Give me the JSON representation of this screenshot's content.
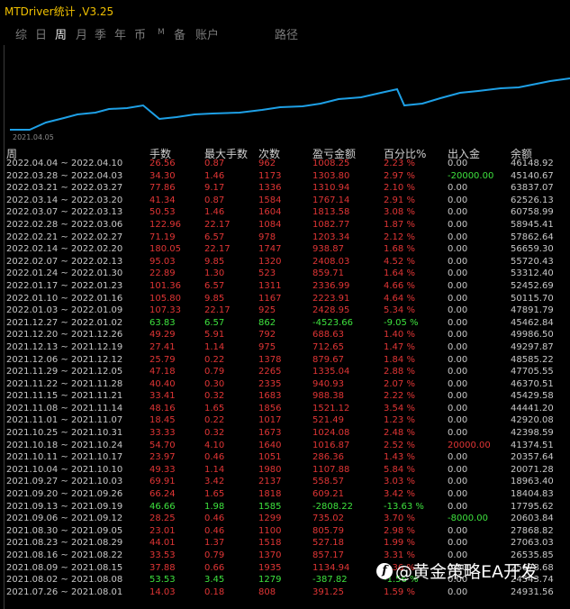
{
  "window": {
    "title": "MTDriver统计 ,V3.25"
  },
  "tabs": [
    {
      "label": "综",
      "active": false
    },
    {
      "label": "日",
      "active": false
    },
    {
      "label": "周",
      "active": true
    },
    {
      "label": "月",
      "active": false
    },
    {
      "label": "季",
      "active": false
    },
    {
      "label": "年",
      "active": false
    },
    {
      "label": "币",
      "active": false
    },
    {
      "label": "M",
      "active": false
    },
    {
      "label": "备",
      "active": false
    },
    {
      "label": "账户",
      "active": false
    },
    {
      "label": "路径",
      "active": false
    }
  ],
  "chart": {
    "start_date": "2021.04.05",
    "line_color": "#1ea0e6"
  },
  "columns": {
    "week": "周",
    "trades": "手数",
    "max_lots": "最大手数",
    "count": "次数",
    "pnl": "盈亏金额",
    "pct": "百分比%",
    "io": "出入金",
    "balance": "余额"
  },
  "colors": {
    "profit": "#e03535",
    "loss": "#3ee23e",
    "neutral": "#c8c8c8"
  },
  "rows": [
    {
      "week": "2022.04.04 ~ 2022.04.10",
      "trades": "26.56",
      "max": "0.87",
      "count": "962",
      "pnl": "1008.25",
      "pct": "2.23 %",
      "io": "0.00",
      "bal": "46148.92",
      "t": "p",
      "iot": "n"
    },
    {
      "week": "2022.03.28 ~ 2022.04.03",
      "trades": "34.30",
      "max": "1.46",
      "count": "1173",
      "pnl": "1303.80",
      "pct": "2.97 %",
      "io": "-20000.00",
      "bal": "45140.67",
      "t": "p",
      "iot": "g"
    },
    {
      "week": "2022.03.21 ~ 2022.03.27",
      "trades": "77.86",
      "max": "9.17",
      "count": "1336",
      "pnl": "1310.94",
      "pct": "2.10 %",
      "io": "0.00",
      "bal": "63837.07",
      "t": "p",
      "iot": "n"
    },
    {
      "week": "2022.03.14 ~ 2022.03.20",
      "trades": "41.34",
      "max": "0.87",
      "count": "1584",
      "pnl": "1767.14",
      "pct": "2.91 %",
      "io": "0.00",
      "bal": "62526.13",
      "t": "p",
      "iot": "n"
    },
    {
      "week": "2022.03.07 ~ 2022.03.13",
      "trades": "50.53",
      "max": "1.46",
      "count": "1604",
      "pnl": "1813.58",
      "pct": "3.08 %",
      "io": "0.00",
      "bal": "60758.99",
      "t": "p",
      "iot": "n"
    },
    {
      "week": "2022.02.28 ~ 2022.03.06",
      "trades": "122.96",
      "max": "22.17",
      "count": "1084",
      "pnl": "1082.77",
      "pct": "1.87 %",
      "io": "0.00",
      "bal": "58945.41",
      "t": "p",
      "iot": "n"
    },
    {
      "week": "2022.02.21 ~ 2022.02.27",
      "trades": "71.19",
      "max": "6.57",
      "count": "978",
      "pnl": "1203.34",
      "pct": "2.12 %",
      "io": "0.00",
      "bal": "57862.64",
      "t": "p",
      "iot": "n"
    },
    {
      "week": "2022.02.14 ~ 2022.02.20",
      "trades": "180.05",
      "max": "22.17",
      "count": "1747",
      "pnl": "938.87",
      "pct": "1.68 %",
      "io": "0.00",
      "bal": "56659.30",
      "t": "p",
      "iot": "n"
    },
    {
      "week": "2022.02.07 ~ 2022.02.13",
      "trades": "95.03",
      "max": "9.85",
      "count": "1320",
      "pnl": "2408.03",
      "pct": "4.52 %",
      "io": "0.00",
      "bal": "55720.43",
      "t": "p",
      "iot": "n"
    },
    {
      "week": "2022.01.24 ~ 2022.01.30",
      "trades": "22.89",
      "max": "1.30",
      "count": "523",
      "pnl": "859.71",
      "pct": "1.64 %",
      "io": "0.00",
      "bal": "53312.40",
      "t": "p",
      "iot": "n"
    },
    {
      "week": "2022.01.17 ~ 2022.01.23",
      "trades": "101.36",
      "max": "6.57",
      "count": "1311",
      "pnl": "2336.99",
      "pct": "4.66 %",
      "io": "0.00",
      "bal": "52452.69",
      "t": "p",
      "iot": "n"
    },
    {
      "week": "2022.01.10 ~ 2022.01.16",
      "trades": "105.80",
      "max": "9.85",
      "count": "1167",
      "pnl": "2223.91",
      "pct": "4.64 %",
      "io": "0.00",
      "bal": "50115.70",
      "t": "p",
      "iot": "n"
    },
    {
      "week": "2022.01.03 ~ 2022.01.09",
      "trades": "107.33",
      "max": "22.17",
      "count": "925",
      "pnl": "2428.95",
      "pct": "5.34 %",
      "io": "0.00",
      "bal": "47891.79",
      "t": "p",
      "iot": "n"
    },
    {
      "week": "2021.12.27 ~ 2022.01.02",
      "trades": "63.83",
      "max": "6.57",
      "count": "862",
      "pnl": "-4523.66",
      "pct": "-9.05 %",
      "io": "0.00",
      "bal": "45462.84",
      "t": "l",
      "iot": "n"
    },
    {
      "week": "2021.12.20 ~ 2021.12.26",
      "trades": "49.29",
      "max": "5.91",
      "count": "792",
      "pnl": "688.63",
      "pct": "1.40 %",
      "io": "0.00",
      "bal": "49986.50",
      "t": "p",
      "iot": "n"
    },
    {
      "week": "2021.12.13 ~ 2021.12.19",
      "trades": "27.41",
      "max": "1.14",
      "count": "975",
      "pnl": "712.65",
      "pct": "1.47 %",
      "io": "0.00",
      "bal": "49297.87",
      "t": "p",
      "iot": "n"
    },
    {
      "week": "2021.12.06 ~ 2021.12.12",
      "trades": "25.79",
      "max": "0.22",
      "count": "1378",
      "pnl": "879.67",
      "pct": "1.84 %",
      "io": "0.00",
      "bal": "48585.22",
      "t": "p",
      "iot": "n"
    },
    {
      "week": "2021.11.29 ~ 2021.12.05",
      "trades": "47.18",
      "max": "0.79",
      "count": "2265",
      "pnl": "1335.04",
      "pct": "2.88 %",
      "io": "0.00",
      "bal": "47705.55",
      "t": "p",
      "iot": "n"
    },
    {
      "week": "2021.11.22 ~ 2021.11.28",
      "trades": "40.40",
      "max": "0.30",
      "count": "2335",
      "pnl": "940.93",
      "pct": "2.07 %",
      "io": "0.00",
      "bal": "46370.51",
      "t": "p",
      "iot": "n"
    },
    {
      "week": "2021.11.15 ~ 2021.11.21",
      "trades": "33.41",
      "max": "0.32",
      "count": "1683",
      "pnl": "988.38",
      "pct": "2.22 %",
      "io": "0.00",
      "bal": "45429.58",
      "t": "p",
      "iot": "n"
    },
    {
      "week": "2021.11.08 ~ 2021.11.14",
      "trades": "48.16",
      "max": "1.65",
      "count": "1856",
      "pnl": "1521.12",
      "pct": "3.54 %",
      "io": "0.00",
      "bal": "44441.20",
      "t": "p",
      "iot": "n"
    },
    {
      "week": "2021.11.01 ~ 2021.11.07",
      "trades": "18.45",
      "max": "0.22",
      "count": "1017",
      "pnl": "521.49",
      "pct": "1.23 %",
      "io": "0.00",
      "bal": "42920.08",
      "t": "p",
      "iot": "n"
    },
    {
      "week": "2021.10.25 ~ 2021.10.31",
      "trades": "33.33",
      "max": "0.32",
      "count": "1673",
      "pnl": "1024.08",
      "pct": "2.48 %",
      "io": "0.00",
      "bal": "42398.59",
      "t": "p",
      "iot": "n"
    },
    {
      "week": "2021.10.18 ~ 2021.10.24",
      "trades": "54.70",
      "max": "4.10",
      "count": "1640",
      "pnl": "1016.87",
      "pct": "2.52 %",
      "io": "20000.00",
      "bal": "41374.51",
      "t": "p",
      "iot": "r"
    },
    {
      "week": "2021.10.11 ~ 2021.10.17",
      "trades": "23.97",
      "max": "0.46",
      "count": "1051",
      "pnl": "286.36",
      "pct": "1.43 %",
      "io": "0.00",
      "bal": "20357.64",
      "t": "p",
      "iot": "n"
    },
    {
      "week": "2021.10.04 ~ 2021.10.10",
      "trades": "49.33",
      "max": "1.14",
      "count": "1980",
      "pnl": "1107.88",
      "pct": "5.84 %",
      "io": "0.00",
      "bal": "20071.28",
      "t": "p",
      "iot": "n"
    },
    {
      "week": "2021.09.27 ~ 2021.10.03",
      "trades": "69.91",
      "max": "3.42",
      "count": "2137",
      "pnl": "558.57",
      "pct": "3.03 %",
      "io": "0.00",
      "bal": "18963.40",
      "t": "p",
      "iot": "n"
    },
    {
      "week": "2021.09.20 ~ 2021.09.26",
      "trades": "66.24",
      "max": "1.65",
      "count": "1818",
      "pnl": "609.21",
      "pct": "3.42 %",
      "io": "0.00",
      "bal": "18404.83",
      "t": "p",
      "iot": "n"
    },
    {
      "week": "2021.09.13 ~ 2021.09.19",
      "trades": "46.66",
      "max": "1.98",
      "count": "1585",
      "pnl": "-2808.22",
      "pct": "-13.63 %",
      "io": "0.00",
      "bal": "17795.62",
      "t": "l",
      "iot": "n"
    },
    {
      "week": "2021.09.06 ~ 2021.09.12",
      "trades": "28.25",
      "max": "0.46",
      "count": "1299",
      "pnl": "735.02",
      "pct": "3.70 %",
      "io": "-8000.00",
      "bal": "20603.84",
      "t": "p",
      "iot": "g"
    },
    {
      "week": "2021.08.30 ~ 2021.09.05",
      "trades": "23.01",
      "max": "0.46",
      "count": "1100",
      "pnl": "805.79",
      "pct": "2.98 %",
      "io": "0.00",
      "bal": "27868.82",
      "t": "p",
      "iot": "n"
    },
    {
      "week": "2021.08.23 ~ 2021.08.29",
      "trades": "44.01",
      "max": "1.37",
      "count": "1518",
      "pnl": "527.18",
      "pct": "1.99 %",
      "io": "0.00",
      "bal": "27063.03",
      "t": "p",
      "iot": "n"
    },
    {
      "week": "2021.08.16 ~ 2021.08.22",
      "trades": "33.53",
      "max": "0.79",
      "count": "1370",
      "pnl": "857.17",
      "pct": "3.31 %",
      "io": "0.00",
      "bal": "26535.85",
      "t": "p",
      "iot": "n"
    },
    {
      "week": "2021.08.09 ~ 2021.08.15",
      "trades": "37.88",
      "max": "0.66",
      "count": "1935",
      "pnl": "1134.94",
      "pct": "4.36 %",
      "io": "0.00",
      "bal": "25678.68",
      "t": "p",
      "iot": "n"
    },
    {
      "week": "2021.08.02 ~ 2021.08.08",
      "trades": "53.53",
      "max": "3.45",
      "count": "1279",
      "pnl": "-387.82",
      "pct": "-1.56 %",
      "io": "0.00",
      "bal": "24543.74",
      "t": "l",
      "iot": "n"
    },
    {
      "week": "2021.07.26 ~ 2021.08.01",
      "trades": "14.03",
      "max": "0.18",
      "count": "808",
      "pnl": "391.25",
      "pct": "1.59 %",
      "io": "0.00",
      "bal": "24931.56",
      "t": "p",
      "iot": "n"
    }
  ],
  "watermark": {
    "logo": "f",
    "text": "@黄金策略EA开发"
  }
}
